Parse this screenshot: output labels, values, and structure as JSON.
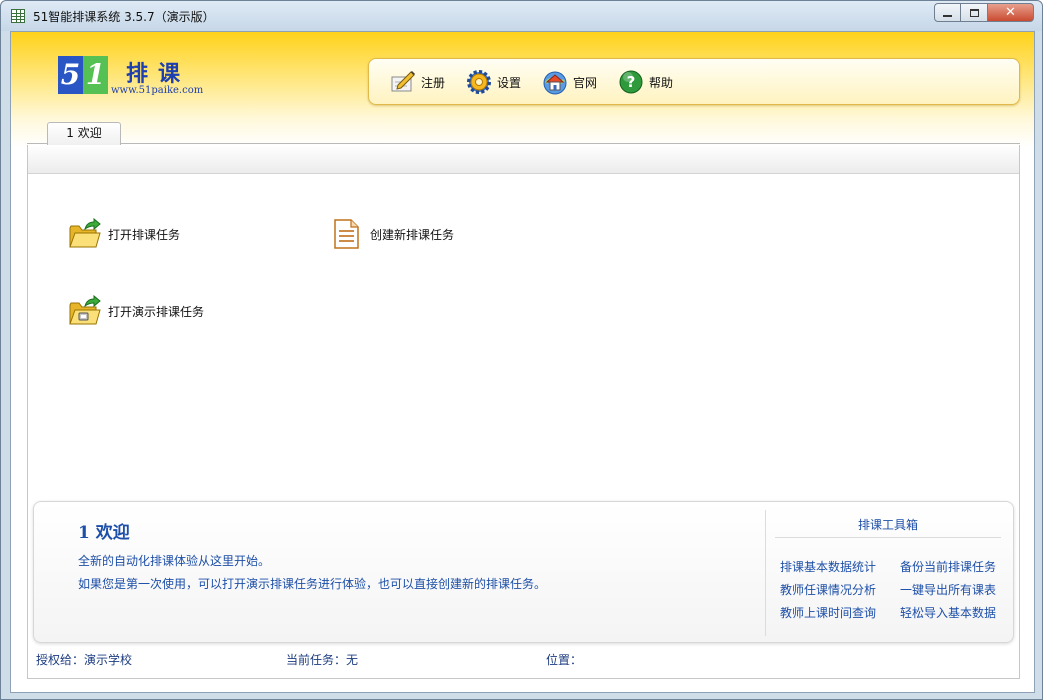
{
  "window": {
    "title": "51智能排课系统 3.5.7（演示版）"
  },
  "logo": {
    "digit1": "5",
    "digit2": "1",
    "name": "排课",
    "url": "www.51paike.com"
  },
  "toolbar": {
    "register_label": "注册",
    "settings_label": "设置",
    "website_label": "官网",
    "help_label": "帮助"
  },
  "tabs": [
    {
      "label": "1 欢迎"
    }
  ],
  "actions": {
    "open_task": "打开排课任务",
    "create_task": "创建新排课任务",
    "open_demo_task": "打开演示排课任务"
  },
  "welcome": {
    "title": "1 欢迎",
    "line1": "全新的自动化排课体验从这里开始。",
    "line2": "如果您是第一次使用，可以打开演示排课任务进行体验，也可以直接创建新的排课任务。"
  },
  "toolbox": {
    "title": "排课工具箱",
    "links": [
      "排课基本数据统计",
      "备份当前排课任务",
      "教师任课情况分析",
      "一键导出所有课表",
      "教师上课时间查询",
      "轻松导入基本数据"
    ]
  },
  "status": {
    "licensed_to": "授权给：演示学校",
    "current_task": "当前任务：无",
    "position": "位置："
  },
  "colors": {
    "header_yellow": "#ffd21a",
    "link_blue": "#1d4fa8",
    "logo_blue": "#2a55c4",
    "logo_green": "#55c155"
  }
}
